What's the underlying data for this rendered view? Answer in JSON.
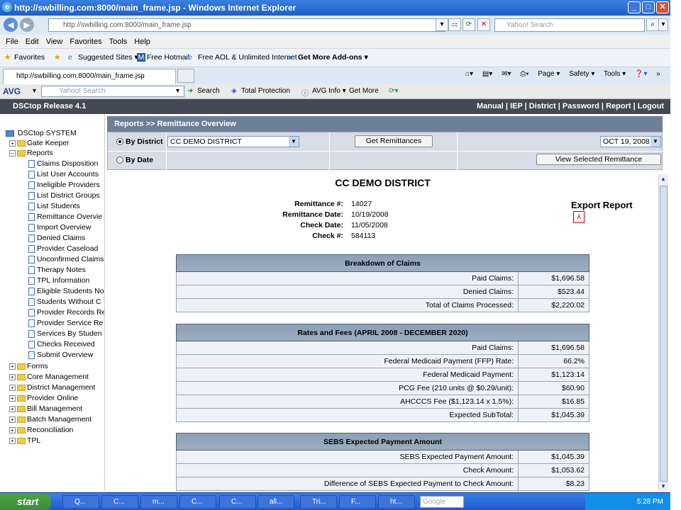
{
  "window": {
    "title": "http://swbilling.com:8000/main_frame.jsp - Windows Internet Explorer"
  },
  "address": {
    "url": "http://swbilling.com:8000/main_frame.jsp",
    "search_placeholder": "Yahoo! Search"
  },
  "menu": [
    "File",
    "Edit",
    "View",
    "Favorites",
    "Tools",
    "Help"
  ],
  "favorites": {
    "label": "Favorites",
    "items": [
      "Suggested Sites ▾",
      "Free Hotmail",
      "Free AOL & Unlimited Internet",
      "Get More Add-ons ▾"
    ]
  },
  "tab": {
    "title": "http://swbilling.com:8000/main_frame.jsp"
  },
  "commands": [
    "Page ▾",
    "Safety ▾",
    "Tools ▾"
  ],
  "avg": {
    "brand": "AVG",
    "search_placeholder": "Yahoo! Search",
    "items": [
      "Search",
      "Total Protection",
      "AVG Info ▾",
      "Get More"
    ]
  },
  "app": {
    "release": "DSCtop Release 4.1",
    "links": [
      "Manual",
      "IEP",
      "District",
      "Password",
      "Report",
      "Logout"
    ]
  },
  "sidebar": {
    "root": "DSCtop SYSTEM",
    "gate_keeper": "Gate Keeper",
    "reports": "Reports",
    "report_items": [
      "Claims Disposition",
      "List User Accounts",
      "Ineligible Providers",
      "List District Groups",
      "List Students",
      "Remittance Overvie",
      "Import Overview",
      "Denied Claims",
      "Provider Caseload",
      "Unconfirmed Claims",
      "Therapy Notes",
      "TPL Information",
      "Eligible Students No",
      "Students Without C",
      "Provider Records Re",
      "Provider Service Re",
      "Services By Studen",
      "Checks Received",
      "Submit Overview"
    ],
    "folders": [
      "Forms",
      "Core Management",
      "District Management",
      "Provider Online",
      "Bill Management",
      "Batch Management",
      "Reconciliation",
      "TPL"
    ]
  },
  "report": {
    "header": "Reports >> Remittance Overview",
    "by_district": "By District",
    "by_date": "By Date",
    "district_value": "CC DEMO DISTRICT",
    "get_button": "Get Remittances",
    "date_value": "OCT 19, 2008",
    "view_button": "View Selected Remittance"
  },
  "remittance": {
    "district": "CC DEMO DISTRICT",
    "fields": [
      {
        "label": "Remittance #:",
        "value": "14027"
      },
      {
        "label": "Remittance Date:",
        "value": "10/19/2008"
      },
      {
        "label": "Check Date:",
        "value": "11/05/2008"
      },
      {
        "label": "Check #:",
        "value": "584113"
      }
    ],
    "export": "Export Report"
  },
  "tables": [
    {
      "title": "Breakdown of Claims",
      "rows": [
        {
          "label": "Paid Claims:",
          "value": "$1,696.58"
        },
        {
          "label": "Denied Claims:",
          "value": "$523.44"
        },
        {
          "label": "Total of Claims Processed:",
          "value": "$2,220.02"
        }
      ]
    },
    {
      "title": "Rates and Fees (APRIL 2008 - DECEMBER 2020)",
      "rows": [
        {
          "label": "Paid Claims:",
          "value": "$1,696.58"
        },
        {
          "label": "Federal Medicaid Payment (FFP) Rate:",
          "value": "66.2%"
        },
        {
          "label": "Federal Medicaid Payment:",
          "value": "$1,123.14"
        },
        {
          "label": "PCG Fee (210 units @ $0.29/unit):",
          "value": "$60.90"
        },
        {
          "label": "AHCCCS Fee ($1,123.14 x 1.5%):",
          "value": "$16.85"
        },
        {
          "label": "Expected SubTotal:",
          "value": "$1,045.39"
        }
      ]
    },
    {
      "title": "SEBS Expected Payment Amount",
      "rows": [
        {
          "label": "SEBS Expected Payment Amount:",
          "value": "$1,045.39"
        },
        {
          "label": "Check Amount:",
          "value": "$1,053.62"
        },
        {
          "label": "Difference of SEBS Expected Payment to Check Amount:",
          "value": "$8.23"
        }
      ]
    }
  ],
  "taskbar": {
    "start": "start",
    "items": [
      "Q...",
      "C...",
      "m...",
      "C...",
      "C...",
      "all...",
      "Tri...",
      "F...",
      "ht..."
    ],
    "search": "Google",
    "clock": "5:28 PM"
  }
}
